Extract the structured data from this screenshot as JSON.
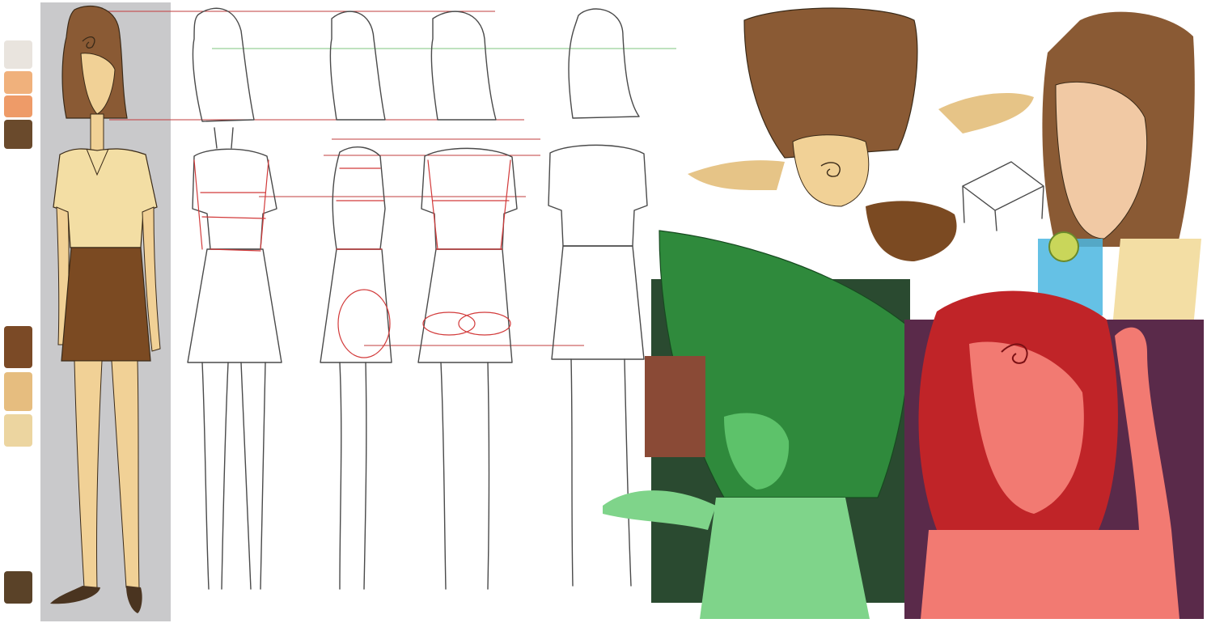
{
  "palette": {
    "swatches": [
      {
        "name": "swatch-pale",
        "color": "#e9e4de"
      },
      {
        "name": "swatch-peach-light",
        "color": "#f0b17c"
      },
      {
        "name": "swatch-peach",
        "color": "#ee9b68"
      },
      {
        "name": "swatch-brown-dark",
        "color": "#6a4a2c"
      },
      {
        "name": "swatch-brown",
        "color": "#7b4a26"
      },
      {
        "name": "swatch-tan",
        "color": "#e6bd7f"
      },
      {
        "name": "swatch-cream",
        "color": "#ecd5a0"
      },
      {
        "name": "swatch-shoe",
        "color": "#5a4228"
      }
    ],
    "panel_color": "#c9c9cb"
  },
  "character": {
    "hair_color": "#8a5a34",
    "skin_color": "#f1d196",
    "shirt_color": "#f3dea4",
    "skirt_color": "#7b4a22",
    "shoe_color": "#4a3420"
  },
  "guides": {
    "red_color": "#c23c3c",
    "green_color": "#7fc47f"
  },
  "sketches": {
    "green_variant_color": "#2f8a3c",
    "red_variant_color": "#c02428",
    "red_variant_skin": "#f27a72",
    "background_purple": "#5a2a4a",
    "drink_color": "#4ab6e0"
  }
}
